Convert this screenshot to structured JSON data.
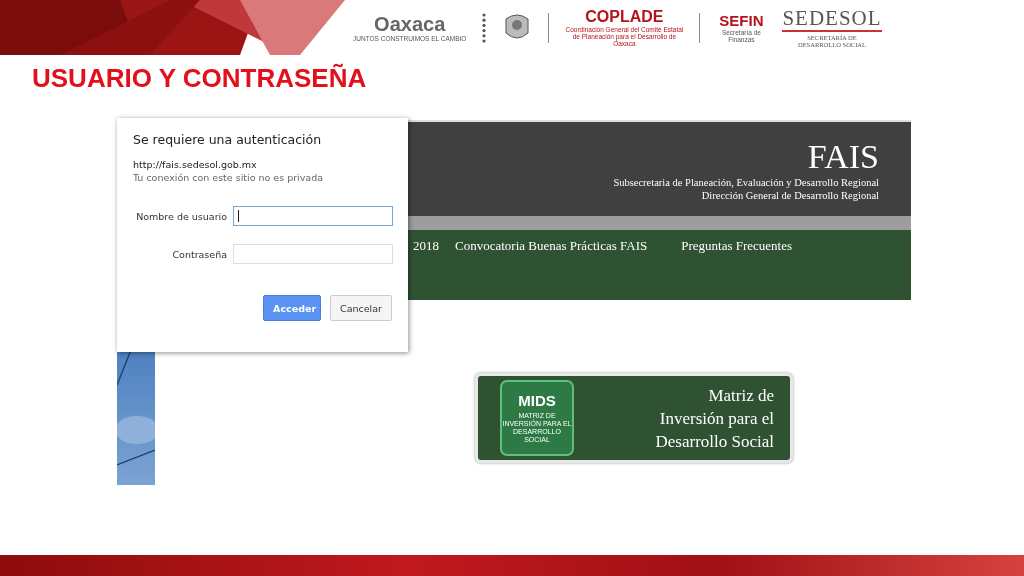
{
  "slide": {
    "title": "USUARIO Y CONTRASEÑA"
  },
  "logos": [
    {
      "kind": "oaxaca",
      "name": "Oaxaca",
      "tagline": "JUNTOS CONSTRUIMOS EL CAMBIO"
    },
    {
      "kind": "emblem"
    },
    {
      "kind": "coplade",
      "name": "COPLADE",
      "tagline": "Coordinación General del Comité Estatal de Planeación para el Desarrollo de Oaxaca"
    },
    {
      "kind": "sefin",
      "name": "SEFIN",
      "tagline": "Secretaría de Finanzas"
    },
    {
      "kind": "sedesol",
      "name": "SEDESOL",
      "tagline": "SECRETARÍA DE DESARROLLO SOCIAL"
    }
  ],
  "website": {
    "title": "FAIS",
    "subtitle_lines": [
      "Subsecretaria de Planeación, Evaluación y Desarrollo Regional",
      "Dirección General de Desarrollo Regional"
    ],
    "nav": [
      "2018",
      "Convocatoria Buenas Prácticas FAIS",
      "Preguntas Frecuentes"
    ],
    "mids": {
      "logo": "MIDS",
      "logo_caption": "MATRIZ DE INVERSIÓN PARA EL DESARROLLO SOCIAL",
      "text_lines": [
        "Matriz de",
        "Inversión para el",
        "Desarrollo Social"
      ]
    }
  },
  "dialog": {
    "title": "Se requiere una autenticación",
    "url": "http://fais.sedesol.gob.mx",
    "notice": "Tu conexión con este sitio no es privada",
    "fields": [
      {
        "label": "Nombre de usuario",
        "focused": true
      },
      {
        "label": "Contraseña",
        "focused": false
      }
    ],
    "buttons": [
      {
        "label": "Acceder",
        "primary": true
      },
      {
        "label": "Cancelar",
        "primary": false
      }
    ]
  }
}
